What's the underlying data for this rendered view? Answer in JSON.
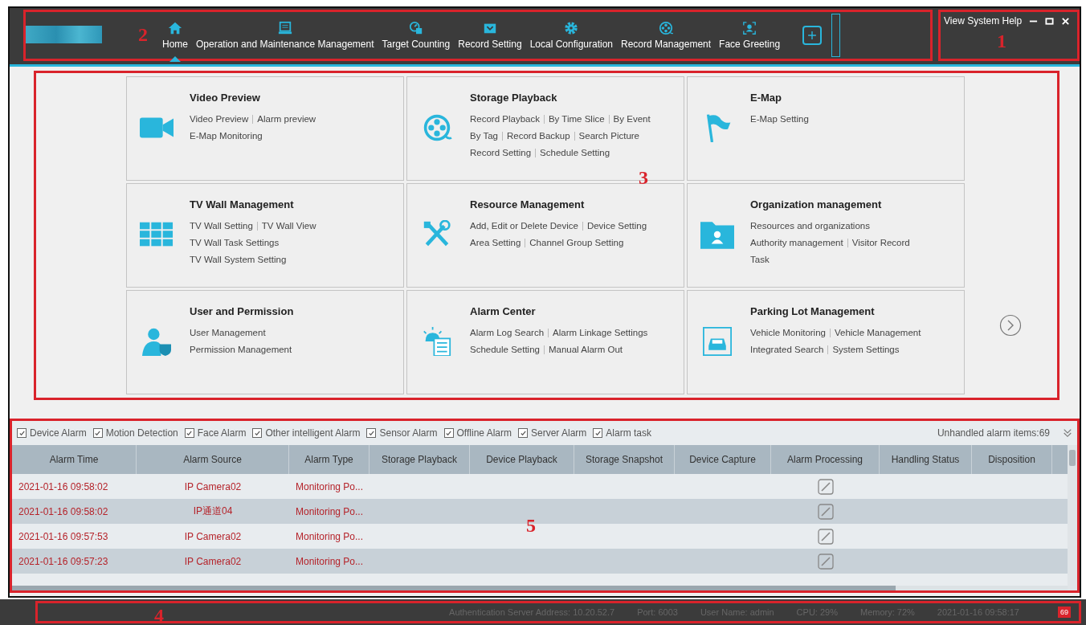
{
  "top_bar": {
    "callout": "2",
    "nav": [
      {
        "label": "Home",
        "kind": "home",
        "selected": true
      },
      {
        "label": "Operation and Maintenance Management",
        "kind": "monitor",
        "selected": false
      },
      {
        "label": "Target Counting",
        "kind": "counter",
        "selected": false
      },
      {
        "label": "Record Setting",
        "kind": "tray",
        "selected": false
      },
      {
        "label": "Local Configuration",
        "kind": "gear",
        "selected": false
      },
      {
        "label": "Record Management",
        "kind": "reel",
        "selected": false
      },
      {
        "label": "Face Greeting",
        "kind": "face",
        "selected": false
      }
    ]
  },
  "window_controls": {
    "callout": "1",
    "menu": "View System Help"
  },
  "modules": {
    "callout": "3",
    "cards": [
      {
        "title": "Video Preview",
        "kind": "camera",
        "lines": [
          [
            "Video Preview",
            "Alarm preview"
          ],
          [
            "E-Map Monitoring"
          ]
        ]
      },
      {
        "title": "Storage Playback",
        "kind": "reel",
        "lines": [
          [
            "Record Playback",
            "By Time Slice",
            "By Event"
          ],
          [
            "By Tag",
            "Record Backup",
            "Search Picture"
          ],
          [
            "Record Setting",
            "Schedule Setting"
          ]
        ]
      },
      {
        "title": "E-Map",
        "kind": "flag",
        "lines": [
          [
            "E-Map Setting"
          ]
        ]
      },
      {
        "title": "TV Wall Management",
        "kind": "wall",
        "lines": [
          [
            "TV Wall Setting",
            "TV Wall View"
          ],
          [
            "TV Wall Task Settings"
          ],
          [
            "TV Wall System Setting"
          ]
        ]
      },
      {
        "title": "Resource Management",
        "kind": "tools",
        "lines": [
          [
            "Add, Edit or Delete Device",
            "Device Setting"
          ],
          [
            "Area Setting",
            "Channel Group Setting"
          ]
        ]
      },
      {
        "title": "Organization management",
        "kind": "folder",
        "lines": [
          [
            "Resources and organizations"
          ],
          [
            "Authority management",
            "Visitor Record"
          ],
          [
            "Task"
          ]
        ]
      },
      {
        "title": "User and Permission",
        "kind": "user",
        "lines": [
          [
            "User Management"
          ],
          [
            "Permission Management"
          ]
        ]
      },
      {
        "title": "Alarm Center",
        "kind": "alarm",
        "lines": [
          [
            "Alarm Log Search",
            "Alarm Linkage Settings"
          ],
          [
            "Schedule Setting",
            "Manual Alarm Out"
          ]
        ]
      },
      {
        "title": "Parking Lot Management",
        "kind": "car",
        "lines": [
          [
            "Vehicle Monitoring",
            "Vehicle Management"
          ],
          [
            "Integrated Search",
            "System Settings"
          ]
        ]
      }
    ]
  },
  "alarm_panel": {
    "callout": "5",
    "filters": [
      {
        "label": "Device Alarm",
        "checked": true
      },
      {
        "label": "Motion Detection",
        "checked": true
      },
      {
        "label": "Face Alarm",
        "checked": true
      },
      {
        "label": "Other intelligent Alarm",
        "checked": true
      },
      {
        "label": "Sensor Alarm",
        "checked": true
      },
      {
        "label": "Offline Alarm",
        "checked": true
      },
      {
        "label": "Server Alarm",
        "checked": true
      },
      {
        "label": "Alarm task",
        "checked": true
      }
    ],
    "unhandled": "Unhandled alarm items:69",
    "columns": [
      "Alarm Time",
      "Alarm Source",
      "Alarm Type",
      "Storage Playback",
      "Device Playback",
      "Storage Snapshot",
      "Device Capture",
      "Alarm Processing",
      "Handling Status",
      "Disposition"
    ],
    "rows": [
      {
        "time": "2021-01-16 09:58:02",
        "source": "IP Camera02",
        "type": "Monitoring Po..."
      },
      {
        "time": "2021-01-16 09:58:02",
        "source": "IP通道04",
        "type": "Monitoring Po..."
      },
      {
        "time": "2021-01-16 09:57:53",
        "source": "IP Camera02",
        "type": "Monitoring Po..."
      },
      {
        "time": "2021-01-16 09:57:23",
        "source": "IP Camera02",
        "type": "Monitoring Po..."
      }
    ]
  },
  "status_bar": {
    "callout": "4",
    "items": [
      "Authentication Server Address: 10.20.52.7",
      "Port: 6003",
      "User Name: admin",
      "CPU: 29%",
      "Memory: 72%",
      "2021-01-16 09:58:17"
    ],
    "badge": "69"
  }
}
